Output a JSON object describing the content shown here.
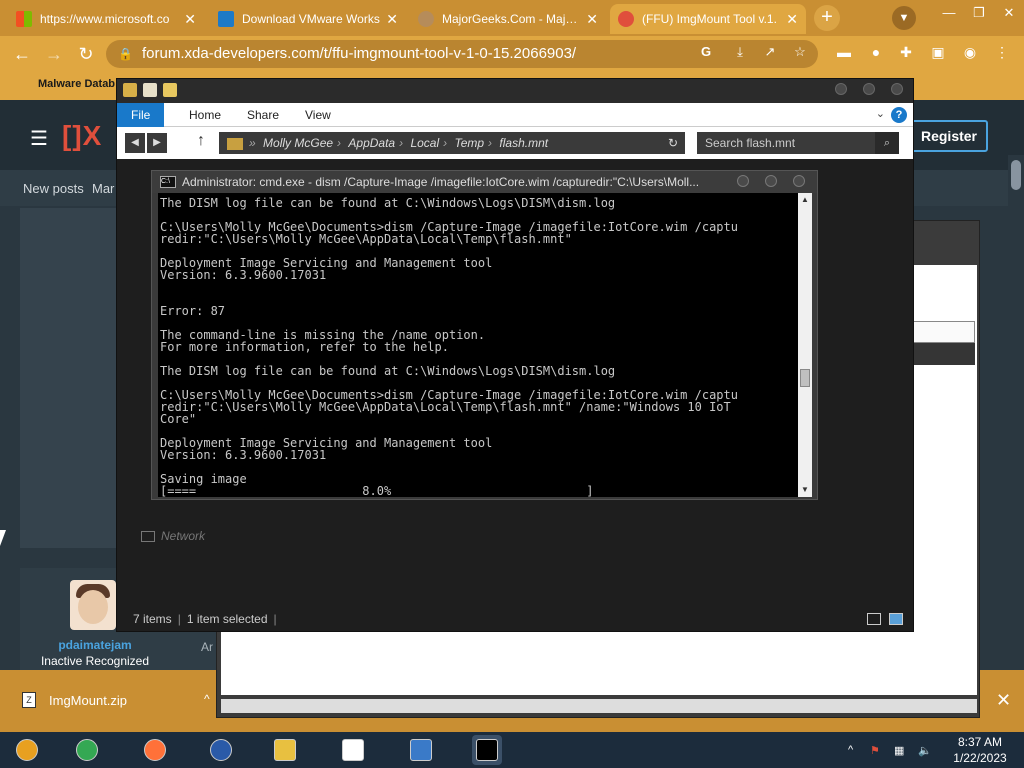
{
  "browser": {
    "tabs": [
      {
        "title": "https://www.microsoft.co",
        "favicon_color": "#f25022"
      },
      {
        "title": "Download VMware Works",
        "favicon_color": "#1d7ac7"
      },
      {
        "title": "MajorGeeks.Com - Majorg",
        "favicon_color": "#b68c5a"
      },
      {
        "title": "(FFU) ImgMount Tool v.1.",
        "favicon_color": "#e04f3c"
      }
    ],
    "url": "forum.xda-developers.com/t/ffu-imgmount-tool-v-1-0-15.2066903/",
    "bookmark": "Malware Datab"
  },
  "site": {
    "logo": "[]X",
    "register_label": "Register",
    "nav": [
      "New posts",
      "Mar"
    ],
    "poster_name": "pdaimatejam",
    "poster_title": "Inactive Recognized",
    "partial_text": "Ar"
  },
  "explorer": {
    "ribbon_tabs": [
      "File",
      "Home",
      "Share",
      "View"
    ],
    "breadcrumb": [
      "Molly McGee",
      "AppData",
      "Local",
      "Temp",
      "flash.mnt"
    ],
    "search_placeholder": "Search flash.mnt",
    "network_label": "Network",
    "status_items": "7 items",
    "status_selected": "1 item selected"
  },
  "cmd": {
    "title": "Administrator: cmd.exe - dism  /Capture-Image /imagefile:IotCore.wim /capturedir:\"C:\\Users\\Moll...",
    "lines": [
      "The DISM log file can be found at C:\\Windows\\Logs\\DISM\\dism.log",
      "",
      "C:\\Users\\Molly McGee\\Documents>dism /Capture-Image /imagefile:IotCore.wim /captu",
      "redir:\"C:\\Users\\Molly McGee\\AppData\\Local\\Temp\\flash.mnt\"",
      "",
      "Deployment Image Servicing and Management tool",
      "Version: 6.3.9600.17031",
      "",
      "",
      "Error: 87",
      "",
      "The command-line is missing the /name option.",
      "For more information, refer to the help.",
      "",
      "The DISM log file can be found at C:\\Windows\\Logs\\DISM\\dism.log",
      "",
      "C:\\Users\\Molly McGee\\Documents>dism /Capture-Image /imagefile:IotCore.wim /captu",
      "redir:\"C:\\Users\\Molly McGee\\AppData\\Local\\Temp\\flash.mnt\" /name:\"Windows 10 IoT",
      "Core\"",
      "",
      "Deployment Image Servicing and Management tool",
      "Version: 6.3.9600.17031",
      "",
      "Saving image",
      "[====                       8.0%                           ]"
    ]
  },
  "download": {
    "filename": "ImgMount.zip"
  },
  "taskbar": {
    "time": "8:37 AM",
    "date": "1/22/2023",
    "apps": [
      {
        "name": "chrome-canary",
        "color": "#e8a020"
      },
      {
        "name": "chrome",
        "color": "#34a853"
      },
      {
        "name": "firefox",
        "color": "#ff7139"
      },
      {
        "name": "obama-logo",
        "color": "#2a5aa8"
      },
      {
        "name": "file-explorer",
        "color": "#e8c040"
      },
      {
        "name": "7zip",
        "color": "#ffffff"
      },
      {
        "name": "control-panel",
        "color": "#3a7ac8"
      },
      {
        "name": "cmd",
        "color": "#000000"
      }
    ]
  },
  "colors": {
    "browser_frame": "#c98f33",
    "accent_blue": "#1979ca",
    "xda_red": "#e04f3c"
  }
}
